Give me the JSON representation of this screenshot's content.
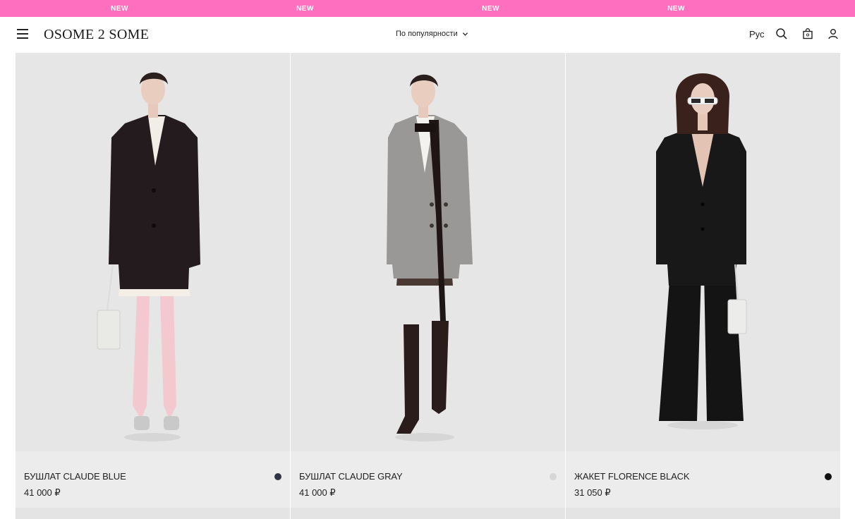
{
  "marquee": {
    "items": [
      "NEW",
      "NEW",
      "NEW",
      "NEW"
    ],
    "color": "#ff6fbf"
  },
  "header": {
    "logo": "OSOME 2 SOME",
    "sort_label": "По популярности",
    "language": "Рус",
    "icons": [
      "menu-icon",
      "search-icon",
      "bag-icon",
      "user-icon"
    ]
  },
  "products": [
    {
      "name": "БУШЛАТ CLAUDE BLUE",
      "price": "41 000 ₽",
      "swatch_color": "#2f3446",
      "garment": "coat-dark-navy"
    },
    {
      "name": "БУШЛАТ CLAUDE GRAY",
      "price": "41 000 ₽",
      "swatch_color": "#d6d6d6",
      "garment": "coat-gray"
    },
    {
      "name": "ЖАКЕТ FLORENCE BLACK",
      "price": "31 050 ₽",
      "swatch_color": "#111111",
      "garment": "suit-black"
    }
  ]
}
